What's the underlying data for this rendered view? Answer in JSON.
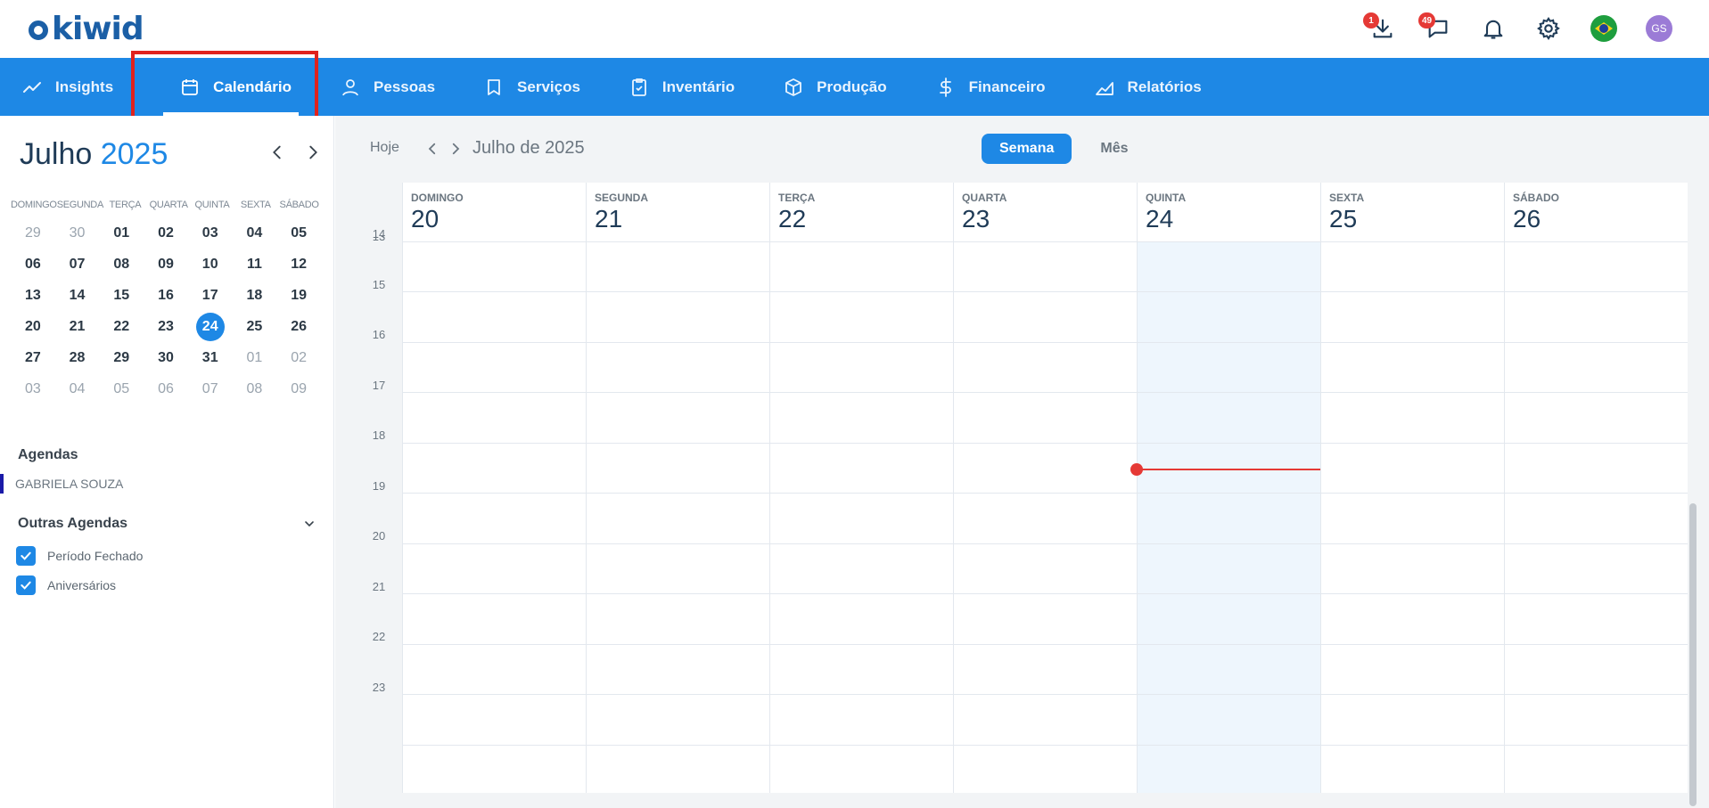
{
  "app": {
    "logo_text": "kiwid"
  },
  "top_icons": {
    "downloads_badge": "1",
    "messages_badge": "49"
  },
  "user": {
    "initials": "GS"
  },
  "nav": [
    {
      "label": "Insights",
      "icon": "trend-line-icon"
    },
    {
      "label": "Calendário",
      "icon": "calendar-icon",
      "active": true
    },
    {
      "label": "Pessoas",
      "icon": "person-icon"
    },
    {
      "label": "Serviços",
      "icon": "tooth-icon"
    },
    {
      "label": "Inventário",
      "icon": "clipboard-check-icon"
    },
    {
      "label": "Produção",
      "icon": "box-icon"
    },
    {
      "label": "Financeiro",
      "icon": "dollar-icon"
    },
    {
      "label": "Relatórios",
      "icon": "chart-area-icon"
    }
  ],
  "mini_calendar": {
    "month": "Julho",
    "year": "2025",
    "weekdays": [
      "DOMINGO",
      "SEGUNDA",
      "TERÇA",
      "QUARTA",
      "QUINTA",
      "SEXTA",
      "SÁBADO"
    ],
    "weeks": [
      [
        "29",
        "30",
        "01",
        "02",
        "03",
        "04",
        "05"
      ],
      [
        "06",
        "07",
        "08",
        "09",
        "10",
        "11",
        "12"
      ],
      [
        "13",
        "14",
        "15",
        "16",
        "17",
        "18",
        "19"
      ],
      [
        "20",
        "21",
        "22",
        "23",
        "24",
        "25",
        "26"
      ],
      [
        "27",
        "28",
        "29",
        "30",
        "31",
        "01",
        "02"
      ],
      [
        "03",
        "04",
        "05",
        "06",
        "07",
        "08",
        "09"
      ]
    ],
    "today": "24"
  },
  "sidebar": {
    "agendas_title": "Agendas",
    "agenda_user": "GABRIELA SOUZA",
    "other_title": "Outras Agendas",
    "other_items": [
      {
        "label": "Período Fechado",
        "checked": true
      },
      {
        "label": "Aniversários",
        "checked": true
      }
    ]
  },
  "toolbar": {
    "today_label": "Hoje",
    "period_label": "Julho de 2025",
    "view_week": "Semana",
    "view_month": "Mês",
    "active_view": "Semana"
  },
  "week": {
    "days": [
      {
        "name": "DOMINGO",
        "date": "20"
      },
      {
        "name": "SEGUNDA",
        "date": "21"
      },
      {
        "name": "TERÇA",
        "date": "22"
      },
      {
        "name": "QUARTA",
        "date": "23"
      },
      {
        "name": "QUINTA",
        "date": "24",
        "today": true
      },
      {
        "name": "SEXTA",
        "date": "25"
      },
      {
        "name": "SÁBADO",
        "date": "26"
      }
    ],
    "hours": [
      "13",
      "14",
      "15",
      "16",
      "17",
      "18",
      "19",
      "20",
      "21",
      "22",
      "23"
    ]
  },
  "colors": {
    "accent": "#1e88e5",
    "now_indicator": "#e53935",
    "highlight_border": "#e0221d"
  }
}
